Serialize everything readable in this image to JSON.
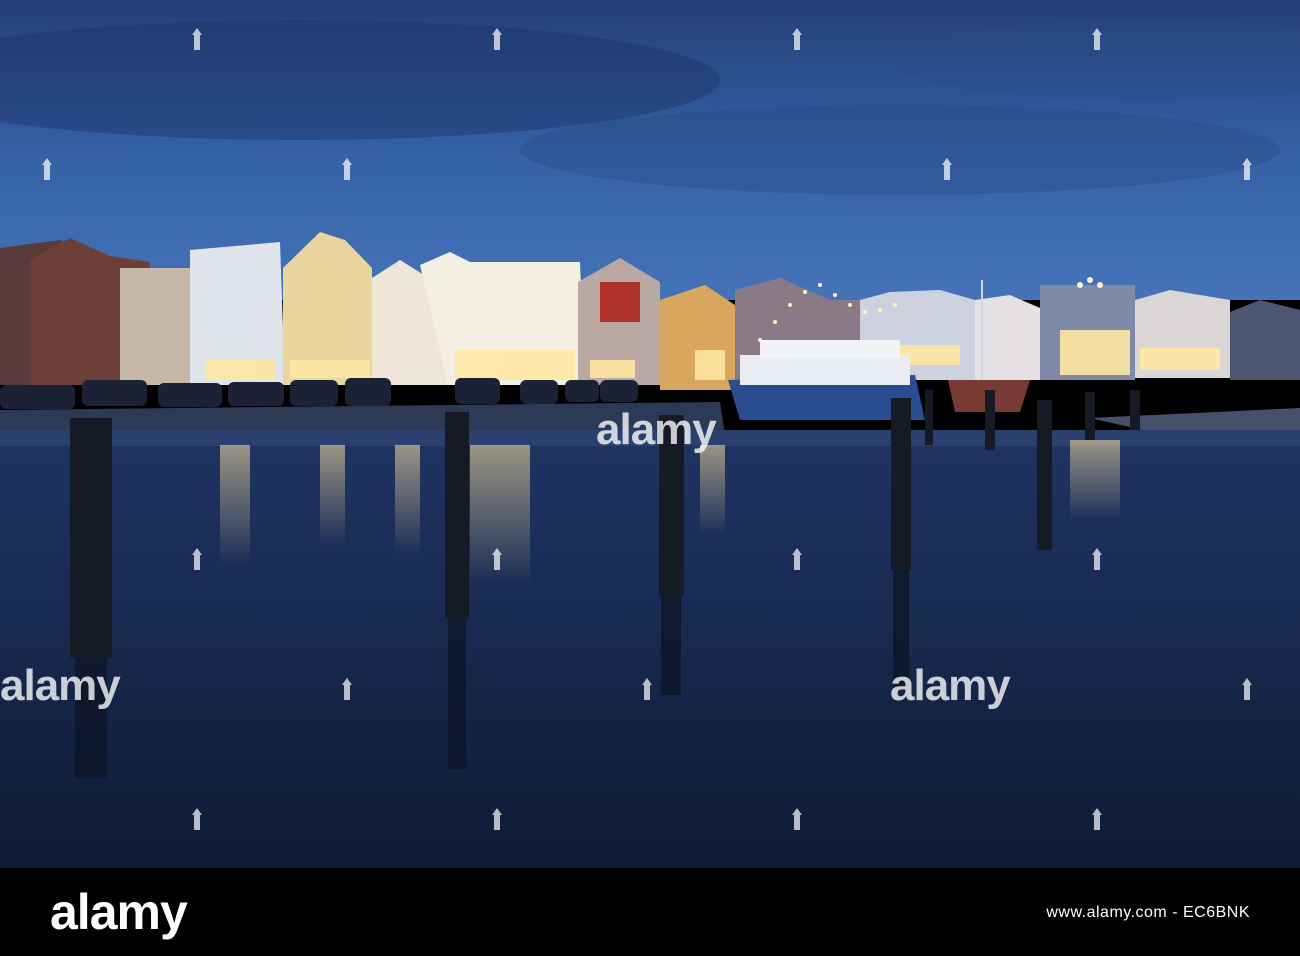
{
  "footer": {
    "brand": "alamy",
    "image_id": "www.alamy.com - EC6BNK"
  },
  "watermark": {
    "text": "alamy"
  },
  "colors": {
    "sky": "#2f4f8c",
    "water": "#17284a",
    "lights": "#ffe7a3"
  }
}
